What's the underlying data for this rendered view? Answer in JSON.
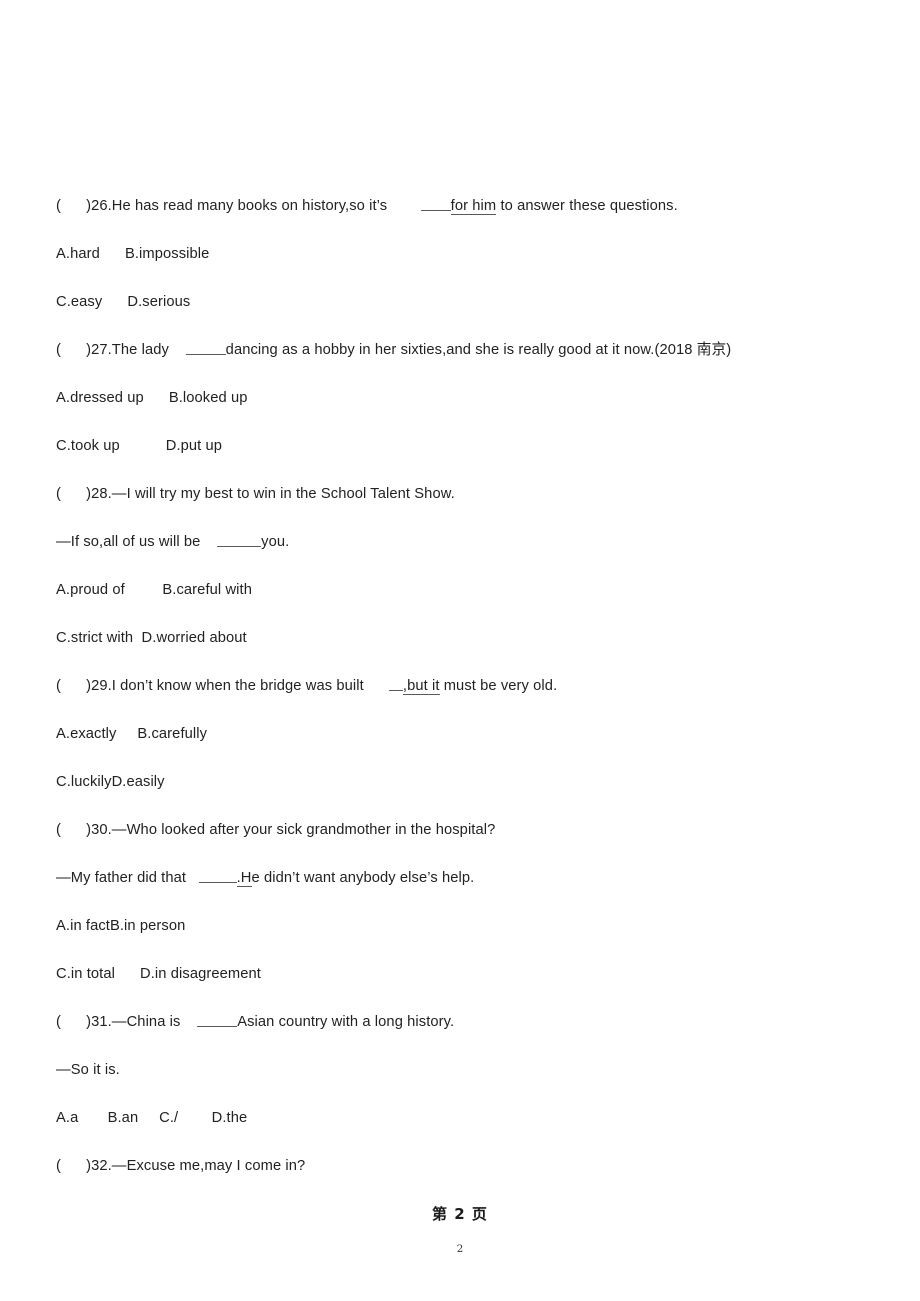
{
  "document": {
    "type": "english-exam-worksheet",
    "background_color": "#ffffff",
    "text_color": "#222222",
    "blank_line_color": "#5a5a5a"
  },
  "questions": [
    {
      "number": "26",
      "marker_open": "(",
      "marker_close": ")",
      "stem_prefix": ")26.He has read many books on history,so it’s",
      "stem_underlined": "for him",
      "stem_suffix": " to answer these questions.",
      "options_line_1": "A.hard      B.impossible",
      "options_line_2": "C.easy      D.serious"
    },
    {
      "number": "27",
      "stem_prefix": ")27.The lady",
      "stem_suffix": "dancing as a hobby in her sixties,and she is really good at it now.(2018 南京)",
      "options_line_1": "A.dressed up      B.looked up",
      "options_line_2": "C.took up           D.put up"
    },
    {
      "number": "28",
      "stem_prefix": ")28.—I will try my best to win in the School Talent Show.",
      "reply_prefix": "—If so,all of us will be",
      "reply_suffix": "you.",
      "options_line_1": "A.proud of         B.careful with",
      "options_line_2": "C.strict with  D.worried about"
    },
    {
      "number": "29",
      "stem_prefix": ")29.I don’t know when the bridge was built",
      "stem_underlined": ",but it",
      "stem_suffix": " must be very old.",
      "options_line_1": "A.exactly     B.carefully",
      "options_line_2": "C.luckilyD.easily"
    },
    {
      "number": "30",
      "stem_prefix": ")30.—Who looked after your sick grandmother in the hospital?",
      "reply_prefix": "—My father did that",
      "reply_underlined": ".H",
      "reply_suffix": "e didn’t want anybody else’s help.",
      "options_line_1": "A.in factB.in person",
      "options_line_2": "C.in total      D.in disagreement"
    },
    {
      "number": "31",
      "stem_prefix": ")31.—China is",
      "stem_suffix": "Asian country with a long history.",
      "reply": "—So it is.",
      "options_line_1": "A.a       B.an     C./        D.the"
    },
    {
      "number": "32",
      "stem_prefix": ")32.—Excuse me,may I come in?"
    }
  ],
  "footer": {
    "page_label": "第 2 页",
    "page_number": "2"
  }
}
